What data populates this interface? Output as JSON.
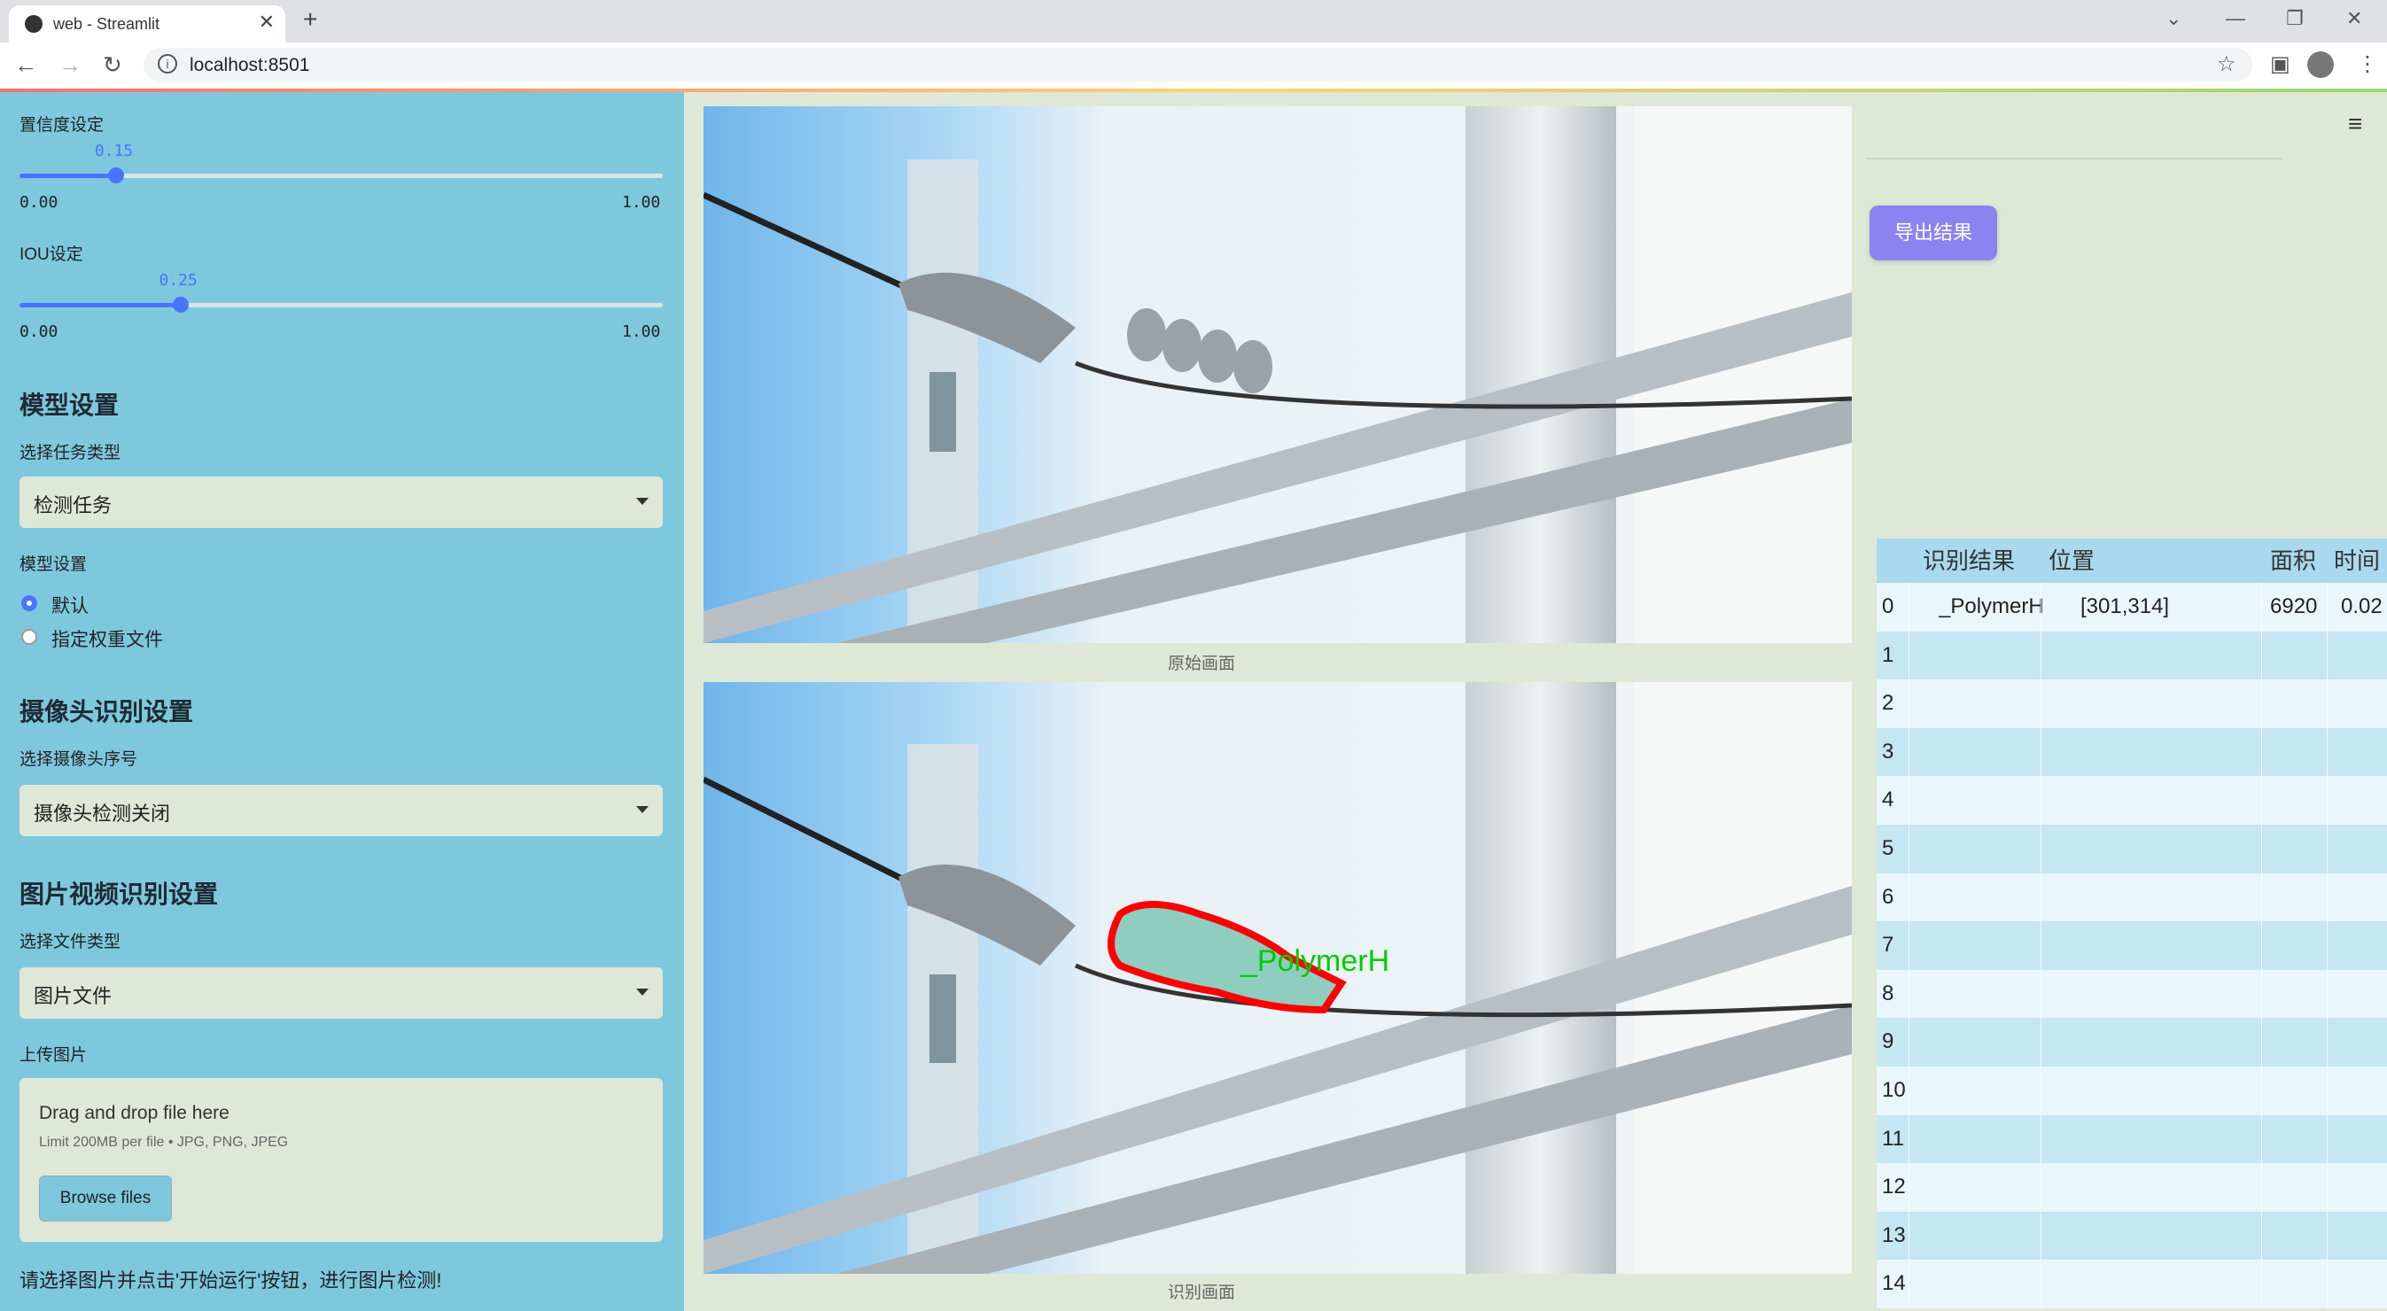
{
  "browser": {
    "tab_title": "web - Streamlit",
    "url": "localhost:8501"
  },
  "sidebar": {
    "confidence": {
      "label": "置信度设定",
      "value": "0.15",
      "min": "0.00",
      "max": "1.00",
      "fraction": 0.15
    },
    "iou": {
      "label": "IOU设定",
      "value": "0.25",
      "min": "0.00",
      "max": "1.00",
      "fraction": 0.25
    },
    "model_header": "模型设置",
    "task_label": "选择任务类型",
    "task_value": "检测任务",
    "model_label": "模型设置",
    "model_options": [
      "默认",
      "指定权重文件"
    ],
    "model_selected": 0,
    "camera_header": "摄像头识别设置",
    "camera_label": "选择摄像头序号",
    "camera_value": "摄像头检测关闭",
    "media_header": "图片视频识别设置",
    "file_type_label": "选择文件类型",
    "file_type_value": "图片文件",
    "upload_label": "上传图片",
    "upload": {
      "title": "Drag and drop file here",
      "limit": "Limit 200MB per file • JPG, PNG, JPEG",
      "button": "Browse files"
    },
    "hint": "请选择图片并点击'开始运行'按钮，进行图片检测!"
  },
  "main": {
    "original_caption": "原始画面",
    "detected_caption": "识别画面",
    "detection_label": "_PolymerH",
    "export_button": "导出结果"
  },
  "table": {
    "headers": [
      "识别结果",
      "位置",
      "面积",
      "时间"
    ],
    "rows": [
      {
        "index": "0",
        "result": "_PolymerH",
        "position": "[301,314]",
        "area": "6920",
        "time": "0.02"
      },
      {
        "index": "1"
      },
      {
        "index": "2"
      },
      {
        "index": "3"
      },
      {
        "index": "4"
      },
      {
        "index": "5"
      },
      {
        "index": "6"
      },
      {
        "index": "7"
      },
      {
        "index": "8"
      },
      {
        "index": "9"
      },
      {
        "index": "10"
      },
      {
        "index": "11"
      },
      {
        "index": "12"
      },
      {
        "index": "13"
      },
      {
        "index": "14"
      }
    ]
  },
  "colors": {
    "sidebar": "#7ec8de",
    "main_bg": "#dfe8d6",
    "accent": "#4a74ff",
    "export_button": "#8b84f0",
    "detection_box": "#ff0000",
    "detection_text": "#00cc00"
  },
  "icons": [
    "streamlit-favicon",
    "close-icon",
    "plus-icon",
    "back-icon",
    "forward-icon",
    "reload-icon",
    "info-icon",
    "star-icon",
    "sidepanel-icon",
    "avatar-icon",
    "menu-icon",
    "chevron-down-icon",
    "hamburger-icon"
  ]
}
